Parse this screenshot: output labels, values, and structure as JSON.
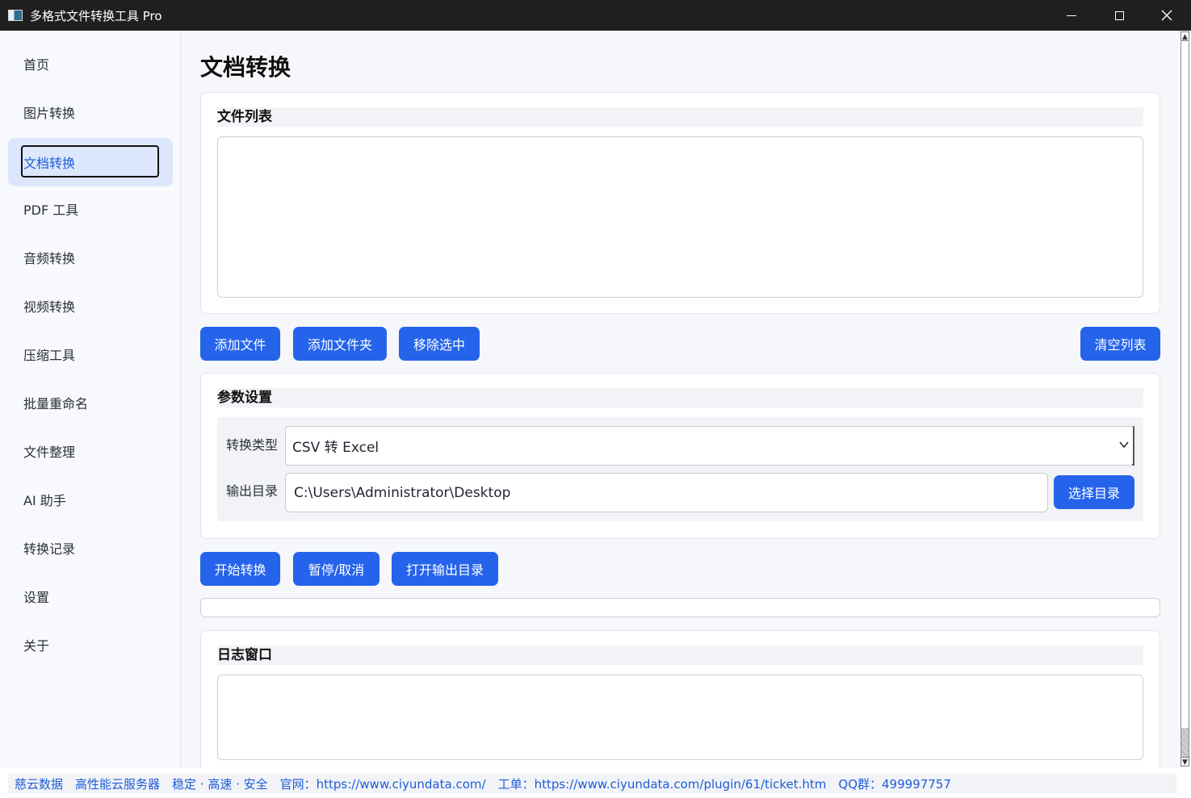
{
  "window": {
    "title": "多格式文件转换工具 Pro"
  },
  "sidebar": {
    "items": [
      {
        "label": "首页",
        "active": false
      },
      {
        "label": "图片转换",
        "active": false
      },
      {
        "label": "文档转换",
        "active": true
      },
      {
        "label": "PDF 工具",
        "active": false
      },
      {
        "label": "音频转换",
        "active": false
      },
      {
        "label": "视频转换",
        "active": false
      },
      {
        "label": "压缩工具",
        "active": false
      },
      {
        "label": "批量重命名",
        "active": false
      },
      {
        "label": "文件整理",
        "active": false
      },
      {
        "label": "AI 助手",
        "active": false
      },
      {
        "label": "转换记录",
        "active": false
      },
      {
        "label": "设置",
        "active": false
      },
      {
        "label": "关于",
        "active": false
      }
    ]
  },
  "main": {
    "title": "文档转换",
    "file_list": {
      "heading": "文件列表"
    },
    "file_buttons": {
      "add_file": "添加文件",
      "add_folder": "添加文件夹",
      "remove_selected": "移除选中",
      "clear_list": "清空列表"
    },
    "params": {
      "heading": "参数设置",
      "conversion_type_label": "转换类型",
      "conversion_type_value": "CSV 转 Excel",
      "output_dir_label": "输出目录",
      "output_dir_value": "C:\\Users\\Administrator\\Desktop",
      "choose_dir_button": "选择目录"
    },
    "action_buttons": {
      "start": "开始转换",
      "pause_cancel": "暂停/取消",
      "open_output": "打开输出目录"
    },
    "progress_fraction": 0,
    "log": {
      "heading": "日志窗口"
    }
  },
  "footer": {
    "items": [
      "慈云数据",
      "高性能云服务器",
      "稳定 · 高速 · 安全",
      "官网：https://www.ciyundata.com/",
      "工单：https://www.ciyundata.com/plugin/61/ticket.htm",
      "QQ群：499997757"
    ]
  },
  "colors": {
    "accent": "#2563eb",
    "titlebar": "#1f1f1f",
    "active_nav_bg": "#dce7fb",
    "footer_link": "#1f5cd6"
  }
}
